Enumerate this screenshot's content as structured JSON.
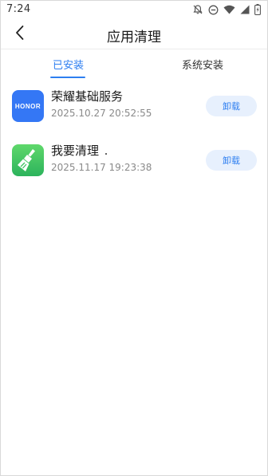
{
  "status_bar": {
    "time": "7:24",
    "icons": [
      "notifications-off-icon",
      "do-not-disturb-icon",
      "wifi-icon",
      "signal-icon",
      "battery-icon"
    ]
  },
  "header": {
    "title": "应用清理",
    "back_icon": "chevron-left-icon"
  },
  "tabs": [
    {
      "label": "已安装",
      "active": true
    },
    {
      "label": "系统安装",
      "active": false
    }
  ],
  "apps": [
    {
      "name": "荣耀基础服务",
      "date": "2025.10.27 20:52:55",
      "icon": "honor-logo-icon",
      "icon_text": "HONOR",
      "icon_color": "#3477f5",
      "action_label": "卸载"
    },
    {
      "name": "我要清理",
      "date": "2025.11.17 19:23:38",
      "icon": "broom-icon",
      "icon_color": "#3cc261",
      "action_label": "卸载"
    }
  ],
  "colors": {
    "accent": "#2d7ef0",
    "button_bg": "#e7f0fd",
    "secondary_text": "#8a8a8a"
  }
}
